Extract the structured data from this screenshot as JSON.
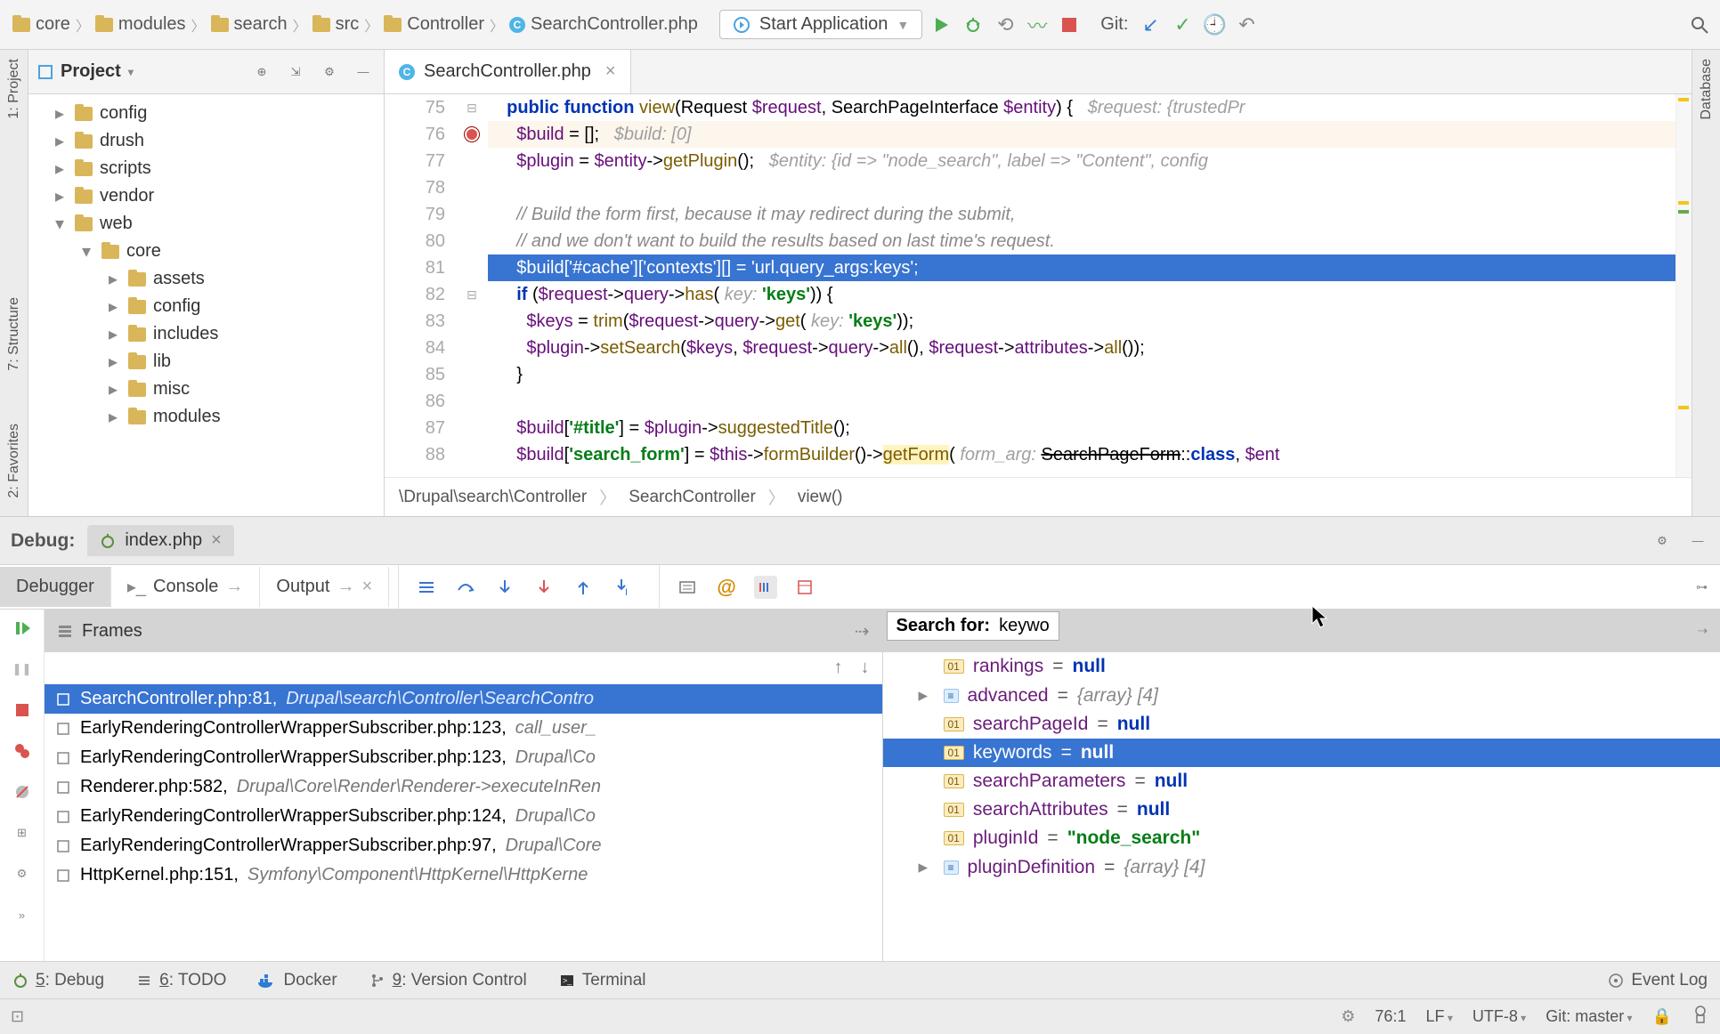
{
  "breadcrumbs": [
    "core",
    "modules",
    "search",
    "src",
    "Controller",
    "SearchController.php"
  ],
  "run_config": "Start Application",
  "git_label": "Git:",
  "left_stripe": [
    "1: Project"
  ],
  "right_stripe": [
    "Database"
  ],
  "project_panel": {
    "title": "Project",
    "tree": [
      {
        "indent": 1,
        "expand": "▸",
        "label": "config"
      },
      {
        "indent": 1,
        "expand": "▸",
        "label": "drush"
      },
      {
        "indent": 1,
        "expand": "▸",
        "label": "scripts"
      },
      {
        "indent": 1,
        "expand": "▸",
        "label": "vendor"
      },
      {
        "indent": 1,
        "expand": "▾",
        "label": "web"
      },
      {
        "indent": 2,
        "expand": "▾",
        "label": "core"
      },
      {
        "indent": 3,
        "expand": "▸",
        "label": "assets"
      },
      {
        "indent": 3,
        "expand": "▸",
        "label": "config"
      },
      {
        "indent": 3,
        "expand": "▸",
        "label": "includes"
      },
      {
        "indent": 3,
        "expand": "▸",
        "label": "lib"
      },
      {
        "indent": 3,
        "expand": "▸",
        "label": "misc"
      },
      {
        "indent": 3,
        "expand": "▸",
        "label": "modules"
      }
    ]
  },
  "editor": {
    "tab_name": "SearchController.php",
    "first_line": 75,
    "lines": [
      {
        "n": 75,
        "html": "  <span class='kw'>public</span> <span class='kw'>function</span> <span class='fn'>view</span>(Request <span class='var'>$request</span>, SearchPageInterface <span class='var'>$entity</span>) {   <span class='hint'>$request: {trustedPr</span>"
      },
      {
        "n": 76,
        "bp": true,
        "warn": true,
        "html": "    <span class='var'>$build</span> = [];   <span class='hint'>$build: [0]</span>"
      },
      {
        "n": 77,
        "html": "    <span class='var'>$plugin</span> = <span class='var'>$entity</span>-&gt;<span class='fn'>getPlugin</span>();   <span class='hint'>$entity: {id =&gt; \"node_search\", label =&gt; \"Content\", config</span>"
      },
      {
        "n": 78,
        "html": ""
      },
      {
        "n": 79,
        "html": "    <span class='cmt'>// Build the form first, because it may redirect during the submit,</span>"
      },
      {
        "n": 80,
        "html": "    <span class='cmt'>// and we don't want to build the results based on last time's request.</span>"
      },
      {
        "n": 81,
        "cur": true,
        "html": "    $build['#cache']['contexts'][] = 'url.query_args:keys';"
      },
      {
        "n": 82,
        "html": "    <span class='kw'>if</span> (<span class='var'>$request</span>-&gt;<span class='var'>query</span>-&gt;<span class='fn'>has</span>( <span class='hint'>key:</span> <span class='str'>'keys'</span>)) {"
      },
      {
        "n": 83,
        "html": "      <span class='var'>$keys</span> = <span class='fn'>trim</span>(<span class='var'>$request</span>-&gt;<span class='var'>query</span>-&gt;<span class='fn'>get</span>( <span class='hint'>key:</span> <span class='str'>'keys'</span>));"
      },
      {
        "n": 84,
        "html": "      <span class='var'>$plugin</span>-&gt;<span class='fn'>setSearch</span>(<span class='var'>$keys</span>, <span class='var'>$request</span>-&gt;<span class='var'>query</span>-&gt;<span class='fn'>all</span>(), <span class='var'>$request</span>-&gt;<span class='var'>attributes</span>-&gt;<span class='fn'>all</span>());"
      },
      {
        "n": 85,
        "html": "    }"
      },
      {
        "n": 86,
        "html": ""
      },
      {
        "n": 87,
        "html": "    <span class='var'>$build</span>[<span class='str'>'#title'</span>] = <span class='var'>$plugin</span>-&gt;<span class='fn'>suggestedTitle</span>();"
      },
      {
        "n": 88,
        "html": "    <span class='var'>$build</span>[<span class='str'>'search_form'</span>] = <span class='var'>$this</span>-&gt;<span class='fn'>formBuilder</span>()-&gt;<span class='fn' style='background:#fff3bf'>getForm</span>( <span class='hint'>form_arg:</span> <s>SearchPageForm</s>::<span class='kw'>class</span>, <span class='var'>$ent</span>"
      }
    ],
    "crumbtrail": [
      "\\Drupal\\search\\Controller",
      "SearchController",
      "view()"
    ]
  },
  "debug": {
    "label": "Debug:",
    "session_tab": "index.php",
    "inner_tabs": [
      "Debugger",
      "Console",
      "Output"
    ],
    "frames_label": "Frames",
    "frames": [
      {
        "sel": true,
        "file": "SearchController.php:81,",
        "loc": "Drupal\\search\\Controller\\SearchContro"
      },
      {
        "file": "EarlyRenderingControllerWrapperSubscriber.php:123,",
        "loc": "call_user_"
      },
      {
        "file": "EarlyRenderingControllerWrapperSubscriber.php:123,",
        "loc": "Drupal\\Co"
      },
      {
        "file": "Renderer.php:582,",
        "loc": "Drupal\\Core\\Render\\Renderer->executeInRen"
      },
      {
        "file": "EarlyRenderingControllerWrapperSubscriber.php:124,",
        "loc": "Drupal\\Co"
      },
      {
        "file": "EarlyRenderingControllerWrapperSubscriber.php:97,",
        "loc": "Drupal\\Core"
      },
      {
        "file": "HttpKernel.php:151,",
        "loc": "Symfony\\Component\\HttpKernel\\HttpKerne"
      }
    ],
    "search_label": "Search for:",
    "search_value": "keywo",
    "vars": [
      {
        "badge": "01",
        "name": "rankings",
        "val": "null",
        "type": "null"
      },
      {
        "arrow": "▸",
        "badge": "arr",
        "name": "advanced",
        "val": "{array} [4]",
        "type": "array"
      },
      {
        "badge": "01",
        "name": "searchPageId",
        "val": "null",
        "type": "null"
      },
      {
        "sel": true,
        "badge": "01",
        "name": "keywords",
        "val": "null",
        "type": "null"
      },
      {
        "badge": "01",
        "name": "searchParameters",
        "val": "null",
        "type": "null"
      },
      {
        "badge": "01",
        "name": "searchAttributes",
        "val": "null",
        "type": "null"
      },
      {
        "badge": "01",
        "name": "pluginId",
        "val": "\"node_search\"",
        "type": "str"
      },
      {
        "arrow": "▸",
        "badge": "arr",
        "name": "pluginDefinition",
        "val": "{array} [4]",
        "type": "array"
      }
    ]
  },
  "bottom_tools": [
    {
      "icon": "bug",
      "label": "5: Debug",
      "u": "5"
    },
    {
      "icon": "list",
      "label": "6: TODO",
      "u": "6"
    },
    {
      "icon": "docker",
      "label": "Docker"
    },
    {
      "icon": "branch",
      "label": "9: Version Control",
      "u": "9"
    },
    {
      "icon": "term",
      "label": "Terminal"
    }
  ],
  "event_log": "Event Log",
  "status": {
    "caret": "76:1",
    "line_sep": "LF",
    "encoding": "UTF-8",
    "git_branch": "Git: master"
  }
}
